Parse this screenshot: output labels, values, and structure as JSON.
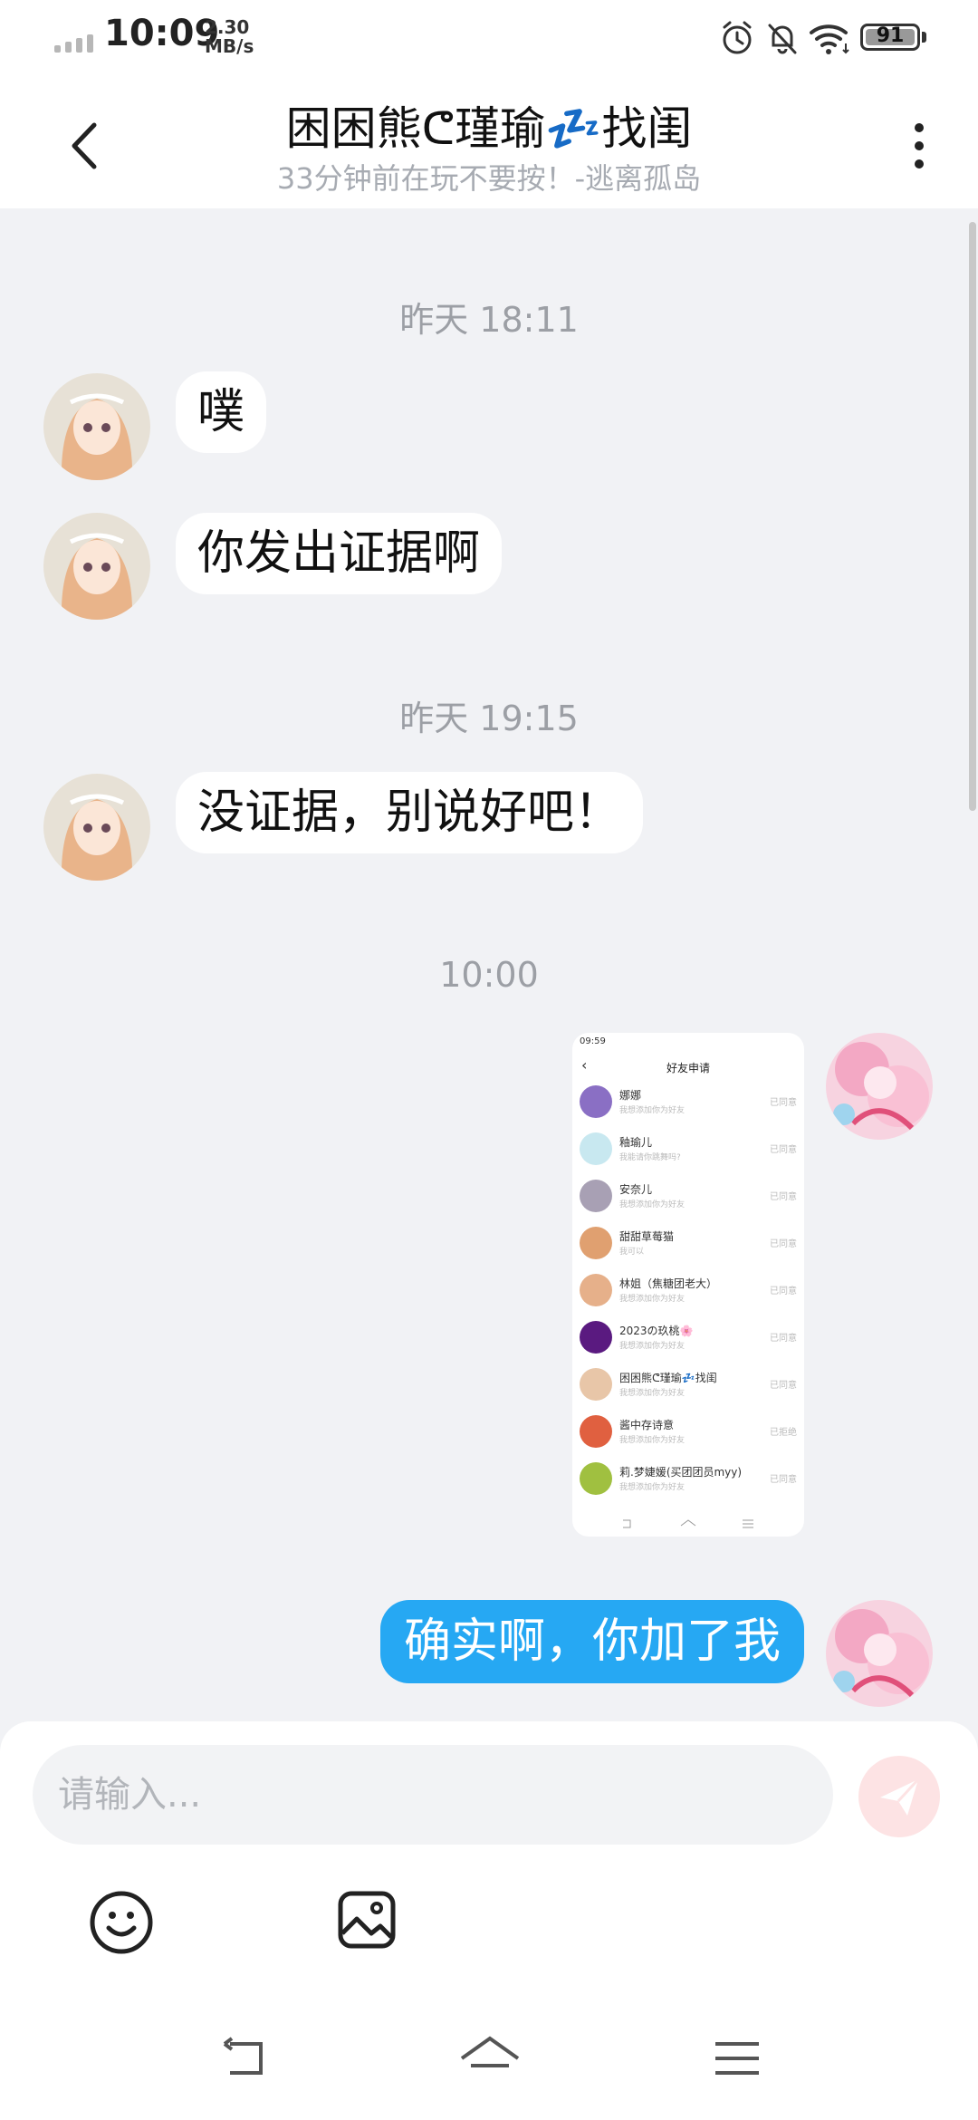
{
  "status_bar": {
    "time": "10:09",
    "speed_value": "2.30",
    "speed_unit": "MB/s",
    "battery": "91",
    "icons": [
      "signal-icon",
      "alarm-icon",
      "mute-bell-icon",
      "wifi-icon",
      "battery-icon"
    ]
  },
  "header": {
    "title": "困困熊ᕦ瑾瑜💤找闺",
    "subtitle": "33分钟前在玩不要按！-逃离孤岛",
    "back_icon": "chevron-left-icon",
    "more_icon": "more-vertical-icon"
  },
  "messages": {
    "t1": "昨天 18:11",
    "m1": "噗",
    "m2": "你发出证据啊",
    "t2": "昨天 19:15",
    "m3": "没证据，别说好吧！",
    "t3": "10:00",
    "m5": "确实啊，你加了我"
  },
  "screenshot": {
    "status_time": "09:59",
    "title": "好友申请",
    "rows": [
      {
        "name": "娜娜",
        "note": "我想添加你为好友",
        "state": "已同意",
        "color": "#8a6fc4"
      },
      {
        "name": "釉瑜儿",
        "note": "我能请你跳舞吗?",
        "state": "已同意",
        "color": "#c8e8f0"
      },
      {
        "name": "安奈儿",
        "note": "我想添加你为好友",
        "state": "已同意",
        "color": "#a8a0b4"
      },
      {
        "name": "甜甜草莓猫",
        "note": "我可以",
        "state": "已同意",
        "color": "#e0a070"
      },
      {
        "name": "林姐（焦糖团老大）",
        "note": "我想添加你为好友",
        "state": "已同意",
        "color": "#e6b08a"
      },
      {
        "name": "2023の玖桃🌸",
        "note": "我想添加你为好友",
        "state": "已同意",
        "color": "#5a1a80"
      },
      {
        "name": "困困熊ᕦ瑾瑜💤找闺",
        "note": "我想添加你为好友",
        "state": "已同意",
        "color": "#e8c6a8"
      },
      {
        "name": "酱中存诗意",
        "note": "我想添加你为好友",
        "state": "已拒绝",
        "color": "#e06040"
      },
      {
        "name": "莉.梦婕媛(买团团员myy)",
        "note": "我想添加你为好友",
        "state": "已同意",
        "color": "#a0c040"
      }
    ]
  },
  "composer": {
    "placeholder": "请输入...",
    "send_icon": "send-icon",
    "emoji_icon": "emoji-icon",
    "image_icon": "image-icon"
  },
  "navigation": {
    "icons": [
      "back-nav-icon",
      "home-nav-icon",
      "menu-nav-icon"
    ]
  },
  "colors": {
    "background": "#f1f2f5",
    "outgoing_bubble": "#26a8f3",
    "incoming_bubble": "#ffffff",
    "send_button": "#fde3e4"
  }
}
